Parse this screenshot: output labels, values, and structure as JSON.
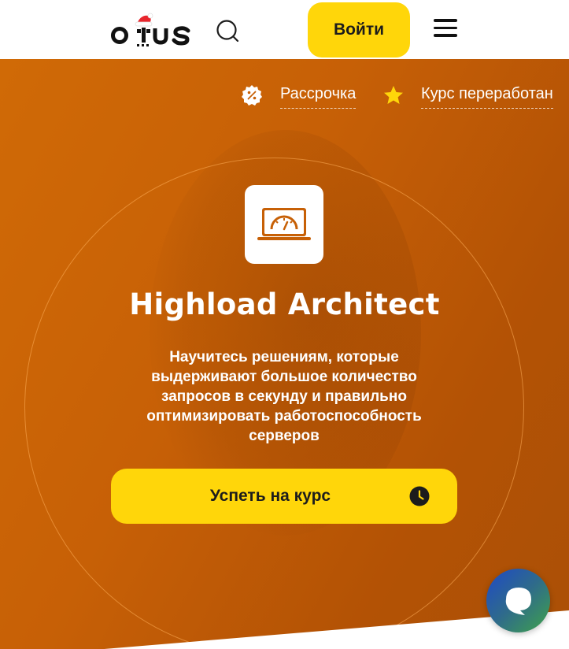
{
  "header": {
    "logo_text": "otus",
    "login_label": "Войти",
    "icons": {
      "search": "search-icon",
      "menu": "hamburger-menu-icon"
    }
  },
  "badges": [
    {
      "label": "Рассрочка",
      "icon": "percent-badge-icon"
    },
    {
      "label": "Курс переработан",
      "icon": "star-icon"
    }
  ],
  "course": {
    "icon": "laptop-speedometer-icon",
    "title": "Highload Architect",
    "description": "Научитесь решениям, которые выдерживают большое количество запросов в секунду и правильно оптимизировать работоспособность серверов"
  },
  "cta": {
    "label": "Успеть на курс",
    "icon": "clock-icon"
  },
  "chat": {
    "icon": "chat-bubble-icon"
  },
  "colors": {
    "accent_yellow": "#ffd60a",
    "hero_orange": "#c76006",
    "text_dark": "#1c1c1c",
    "logo_hat_red": "#e8262d"
  }
}
